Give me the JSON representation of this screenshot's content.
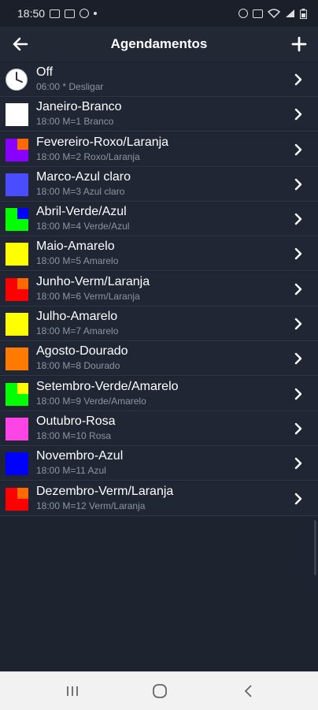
{
  "status_bar": {
    "time": "18:50"
  },
  "header": {
    "title": "Agendamentos"
  },
  "schedules": [
    {
      "name": "Off",
      "detail": "06:00 * Desligar",
      "icon": "clock-icon",
      "main": "",
      "corner": ""
    },
    {
      "name": "Janeiro-Branco",
      "detail": "18:00 M=1 Branco",
      "icon": "color-swatch",
      "main": "#ffffff",
      "corner": ""
    },
    {
      "name": "Fevereiro-Roxo/Laranja",
      "detail": "18:00 M=2 Roxo/Laranja",
      "icon": "color-swatch",
      "main": "#8a00ff",
      "corner": "#ff6a00"
    },
    {
      "name": "Marco-Azul claro",
      "detail": "18:00 M=3 Azul claro",
      "icon": "color-swatch",
      "main": "#4a4cff",
      "corner": ""
    },
    {
      "name": "Abril-Verde/Azul",
      "detail": "18:00 M=4 Verde/Azul",
      "icon": "color-swatch",
      "main": "#00ff00",
      "corner": "#0000ff"
    },
    {
      "name": "Maio-Amarelo",
      "detail": "18:00 M=5 Amarelo",
      "icon": "color-swatch",
      "main": "#ffff00",
      "corner": ""
    },
    {
      "name": "Junho-Verm/Laranja",
      "detail": "18:00 M=6 Verm/Laranja",
      "icon": "color-swatch",
      "main": "#ff0000",
      "corner": "#ff6a00"
    },
    {
      "name": "Julho-Amarelo",
      "detail": "18:00 M=7 Amarelo",
      "icon": "color-swatch",
      "main": "#ffff00",
      "corner": ""
    },
    {
      "name": "Agosto-Dourado",
      "detail": "18:00 M=8 Dourado",
      "icon": "color-swatch",
      "main": "#ff7a00",
      "corner": ""
    },
    {
      "name": "Setembro-Verde/Amarelo",
      "detail": "18:00 M=9 Verde/Amarelo",
      "icon": "color-swatch",
      "main": "#00ff00",
      "corner": "#ffff00"
    },
    {
      "name": "Outubro-Rosa",
      "detail": "18:00 M=10 Rosa",
      "icon": "color-swatch",
      "main": "#ff44e6",
      "corner": ""
    },
    {
      "name": "Novembro-Azul",
      "detail": "18:00 M=11 Azul",
      "icon": "color-swatch",
      "main": "#0000ff",
      "corner": ""
    },
    {
      "name": "Dezembro-Verm/Laranja",
      "detail": "18:00 M=12 Verm/Laranja",
      "icon": "color-swatch",
      "main": "#ff0000",
      "corner": "#ff6a00"
    }
  ],
  "colors": {
    "background": "#1e2330",
    "row_bg": "#202633",
    "subtext": "#8e94a0"
  }
}
